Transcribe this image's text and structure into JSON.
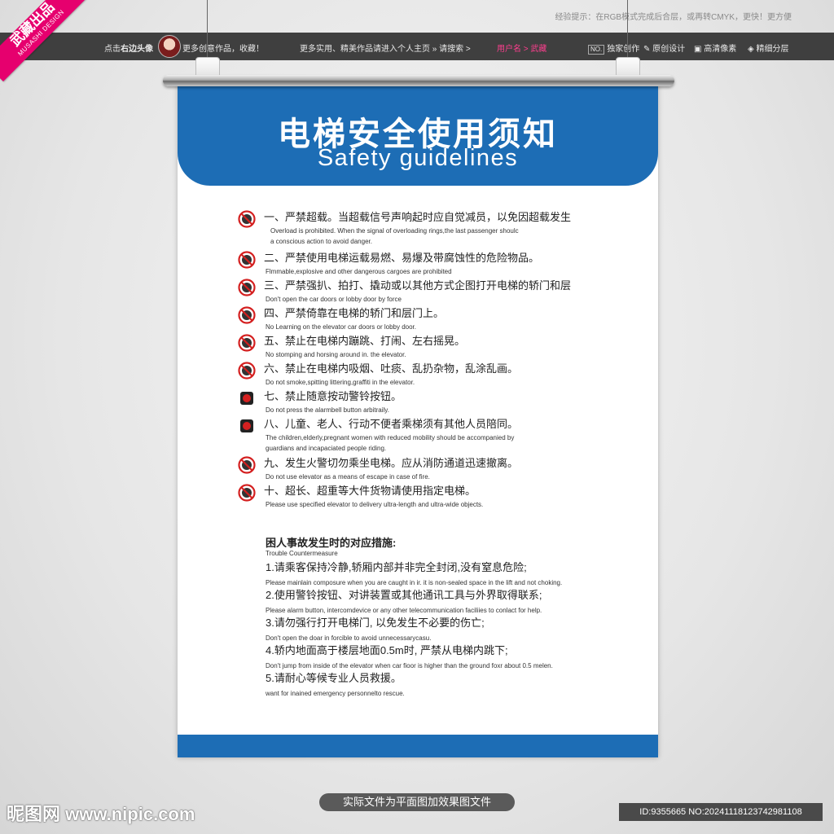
{
  "top_hint": "经验提示：在RGB模式完成后合层，或再转CMYK，更快！更方便",
  "ribbon": {
    "brand": "武藏出品",
    "sub": "MUSASHI DESIGN"
  },
  "bar": {
    "click_avatar": "点击",
    "click_avatar_bold": "右边头像",
    "more_works": "更多创意作品，收藏！",
    "search_hint": "更多实用、精美作品请进入个人主页 » 请搜索 >",
    "search_user": "用户名 > 武藏",
    "exclusive": "独家创作",
    "original": "原创设计",
    "hd": "高清像素",
    "layers": "精细分层",
    "no_badge": "NO."
  },
  "poster": {
    "title_cn": "电梯安全使用须知",
    "title_en": "Safety guidelines",
    "rules": [
      {
        "cn": "一、严禁超载。当超载信号声响起时应自觉减员，以免因超载发生",
        "en": [
          "Overload is prohibited. When the signal of overloading rings,the last passenger shoulc",
          "a conscious action to avoid danger."
        ]
      },
      {
        "cn": "二、严禁使用电梯运载易燃、易爆及带腐蚀性的危险物品。",
        "en": [
          "Flmmable,explosive and other dangerous cargoes are prohibited"
        ]
      },
      {
        "cn": "三、严禁强扒、拍打、撬动或以其他方式企图打开电梯的轿门和层",
        "en": [
          "Don't open the car doors or lobby door by force"
        ]
      },
      {
        "cn": "四、严禁倚靠在电梯的轿门和层门上。",
        "en": [
          "No Learning on the elevator car doors or lobby door."
        ]
      },
      {
        "cn": "五、禁止在电梯内蹦跳、打闹、左右摇晃。",
        "en": [
          "No stomping and horsing around in. the elevator."
        ]
      },
      {
        "cn": "六、禁止在电梯内吸烟、吐痰、乱扔杂物，乱涂乱画。",
        "en": [
          "Do not smoke,spitting littering,graffiti in the elevator."
        ]
      },
      {
        "cn": "七、禁止随意按动警铃按钮。",
        "en": [
          "Do not press the alarmbell button arbitraily."
        ]
      },
      {
        "cn": "八、儿童、老人、行动不便者乘梯须有其他人员陪同。",
        "en": [
          "The children,elderly,pregnant women with reduced mobility should be accompanied by",
          "guardians and incapaciated people riding."
        ]
      },
      {
        "cn": "九、发生火警切勿乘坐电梯。应从消防通道迅速撤离。",
        "en": [
          "Do not use elevator as a means of escape in case of fire."
        ]
      },
      {
        "cn": "十、超长、超重等大件货物请使用指定电梯。",
        "en": [
          "Please use specified elevator to delivery ultra-length and ultra-wide objects."
        ]
      }
    ],
    "measures_title": "困人事故发生时的对应措施:",
    "measures_sub": "Trouble Countermeasure",
    "measures": [
      {
        "cn": "1.请乘客保持冷静,轿厢内部并非完全封闭,没有窒息危险;",
        "en": "Please mainlain composure when you are caught in ir. it is non-sealed space in the lift and not choking."
      },
      {
        "cn": "2.使用警铃按钮、对讲装置或其他通讯工具与外界取得联系;",
        "en": "Please alarm button, intercomdevice or any other telecommunication faciliies to conlact for help."
      },
      {
        "cn": "3.请勿强行打开电梯门, 以免发生不必要的伤亡;",
        "en": "Don't open the doar in forcible to avoid unnecessarycasu."
      },
      {
        "cn": "4.轿内地面高于楼层地面0.5m时, 严禁从电梯内跳下;",
        "en": "Don't jump from inside of the elevator when car fioor is higher than the ground foxr about 0.5 melen."
      },
      {
        "cn": "5.请耐心等候专业人员救援。",
        "en": "want for inained emergency personnelto rescue."
      }
    ]
  },
  "bottom": {
    "caption": "实际文件为平面图加效果图文件",
    "logo": "昵图网 www.nipic.com",
    "id": "ID:9355665 NO:20241118123742981108"
  },
  "colors": {
    "primary_blue": "#1d6db5",
    "prohibition_red": "#d42020",
    "ribbon_pink": "#e6006e"
  },
  "icons": [
    "no-overload-icon",
    "no-flammable-icon",
    "no-force-door-icon",
    "no-leaning-icon",
    "no-jumping-icon",
    "no-smoking-icon",
    "no-alarm-press-icon",
    "accompany-icon",
    "no-elevator-fire-icon",
    "oversize-cargo-icon"
  ]
}
